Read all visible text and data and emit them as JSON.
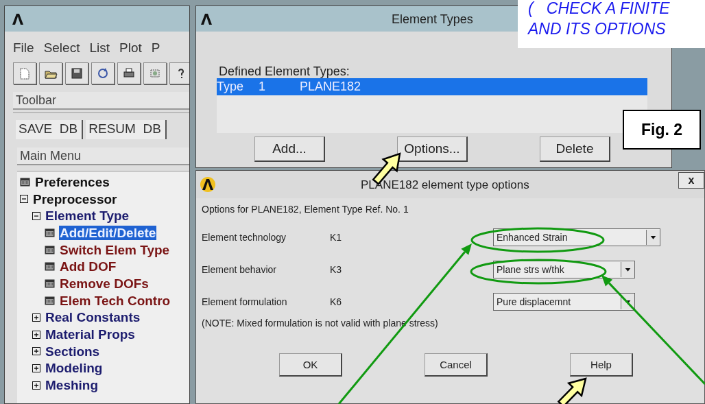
{
  "main_window": {
    "menu": [
      "File",
      "Select",
      "List",
      "Plot",
      "P"
    ],
    "toolbar_label": "Toolbar",
    "toolbar_buttons": [
      "SAVE  DB",
      "RESUM  DB"
    ],
    "main_menu_label": "Main Menu",
    "tree": [
      {
        "label": "Preferences",
        "kind": "action",
        "selected": false
      },
      {
        "label": "Preprocessor",
        "kind": "folder",
        "expanded": true,
        "children": [
          {
            "label": "Element Type",
            "kind": "folder",
            "expanded": true,
            "children": [
              {
                "label": "Add/Edit/Delete",
                "kind": "action",
                "selected": true
              },
              {
                "label": "Switch Elem Type",
                "kind": "action",
                "selected": false
              },
              {
                "label": "Add DOF",
                "kind": "action",
                "selected": false
              },
              {
                "label": "Remove DOFs",
                "kind": "action",
                "selected": false
              },
              {
                "label": "Elem Tech Contro",
                "kind": "action",
                "selected": false
              }
            ]
          },
          {
            "label": "Real Constants",
            "kind": "folder",
            "expanded": false
          },
          {
            "label": "Material Props",
            "kind": "folder",
            "expanded": false
          },
          {
            "label": "Sections",
            "kind": "folder",
            "expanded": false
          },
          {
            "label": "Modeling",
            "kind": "folder",
            "expanded": false
          },
          {
            "label": "Meshing",
            "kind": "folder",
            "expanded": false
          }
        ]
      }
    ]
  },
  "element_types_window": {
    "title": "Element Types",
    "list_label": "Defined Element Types:",
    "rows": [
      {
        "type": "Type",
        "number": "1",
        "name": "PLANE182",
        "selected": true
      }
    ],
    "buttons": [
      "Add...",
      "Options...",
      "Delete"
    ]
  },
  "options_dialog": {
    "title": "PLANE182 element type options",
    "close": "x",
    "subtitle": "Options for PLANE182, Element Type Ref. No. 1",
    "options": [
      {
        "label": "Element technology",
        "key": "K1",
        "value": "Enhanced Strain"
      },
      {
        "label": "Element behavior",
        "key": "K3",
        "value": "Plane strs w/thk"
      },
      {
        "label": "Element formulation",
        "key": "K6",
        "value": "Pure displacemnt"
      }
    ],
    "note": "(NOTE: Mixed formulation is not valid with plane stress)",
    "buttons": [
      "OK",
      "Cancel",
      "Help"
    ]
  },
  "annotations": {
    "callout_lines": [
      "(   CHECK A FINITE",
      "AND ITS OPTIONS"
    ],
    "figure_label": "Fig. 2"
  }
}
